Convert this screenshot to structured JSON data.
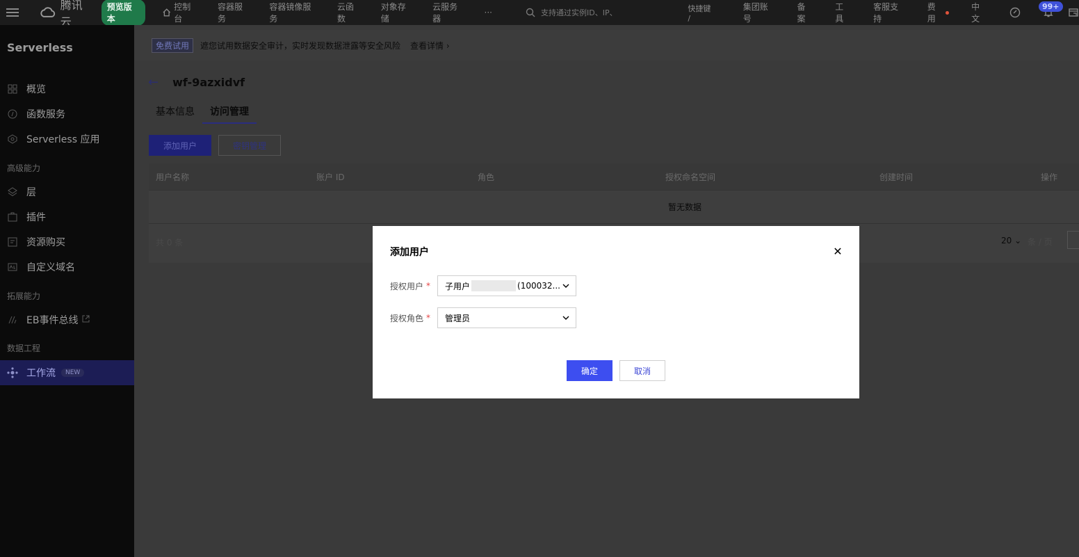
{
  "topbar": {
    "brand": "腾讯云",
    "preview_badge": "预览版本",
    "nav": [
      "控制台",
      "容器服务",
      "容器镜像服务",
      "云函数",
      "对象存储",
      "云服务器"
    ],
    "more": "···",
    "search_placeholder": "支持通过实例ID、IP、",
    "shortcut": "快捷键 /",
    "right": [
      "集团账号",
      "备案",
      "工具",
      "客服支持",
      "费用",
      "中文"
    ],
    "notif_count": "99+"
  },
  "sidebar": {
    "title": "Serverless",
    "items": [
      {
        "label": "概览",
        "icon": "grid-icon"
      },
      {
        "label": "函数服务",
        "icon": "function-icon"
      },
      {
        "label": "Serverless 应用",
        "icon": "app-icon"
      }
    ],
    "section_advanced": "高级能力",
    "advanced_items": [
      {
        "label": "层",
        "icon": "layer-icon"
      },
      {
        "label": "插件",
        "icon": "plugin-icon"
      },
      {
        "label": "资源购买",
        "icon": "purchase-icon"
      },
      {
        "label": "自定义域名",
        "icon": "domain-icon"
      }
    ],
    "section_ext": "拓展能力",
    "ext_items": [
      {
        "label": "EB事件总线",
        "icon": "eventbus-icon"
      }
    ],
    "section_data": "数据工程",
    "data_items": [
      {
        "label": "工作流",
        "icon": "workflow-icon",
        "badge": "NEW"
      }
    ]
  },
  "notice": {
    "tag": "免费试用",
    "text": "遮您试用数据安全审计，实时发现数据泄露等安全风险",
    "link": "查看详情"
  },
  "page": {
    "title": "wf-9azxidvf",
    "tabs": [
      "基本信息",
      "访问管理"
    ],
    "add_user_button": "添加用户",
    "key_manage_button": "密钥管理",
    "table": {
      "columns": [
        "用户名称",
        "账户 ID",
        "角色",
        "授权命名空间",
        "创建时间",
        "操作"
      ],
      "empty": "暂无数据",
      "total": "共 0 条",
      "page_size": "20",
      "per_page": "条 / 页"
    }
  },
  "modal": {
    "title": "添加用户",
    "fields": [
      {
        "label": "授权用户",
        "value_prefix": "子用户",
        "value_suffix": "(100032..."
      },
      {
        "label": "授权角色",
        "value": "管理员"
      }
    ],
    "confirm": "确定",
    "cancel": "取消"
  }
}
